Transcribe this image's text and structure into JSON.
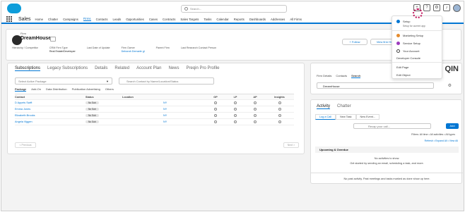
{
  "header": {
    "search_placeholder": "Search...",
    "utility_icons": [
      "add-icon",
      "help-icon",
      "setup-gear-icon",
      "bell-icon",
      "avatar-icon"
    ]
  },
  "nav": {
    "app_name": "Sales",
    "items": [
      "Home",
      "Chatter",
      "Campaigns",
      "Firms",
      "Contacts",
      "Leads",
      "Opportunities",
      "Cases",
      "Contracts",
      "Sales Targets",
      "Tasks",
      "Calendar",
      "Reports",
      "Dashboards",
      "Addresses",
      "All Firms"
    ],
    "active_index": 3
  },
  "record": {
    "type": "Firm",
    "name": "DreamHouse",
    "fields": [
      {
        "label": "Hierarchy / Competitor",
        "value": ""
      },
      {
        "label": "CRM Firm Type",
        "value": "Real Estate/Developer"
      },
      {
        "label": "Last Date of Update",
        "value": ""
      },
      {
        "label": "Firm Owner",
        "value": "Deborah Demarle gl"
      },
      {
        "label": "Parent Firm",
        "value": ""
      },
      {
        "label": "Last Research Contact Person",
        "value": ""
      }
    ],
    "follow_label": "+ Follow",
    "view_label": "View firm Hierarchy"
  },
  "left_panel": {
    "tabs": [
      "Subscriptions",
      "Legacy Subscriptions",
      "Details",
      "Related",
      "Account Plan",
      "News",
      "Preqin Pro Profile"
    ],
    "active_tab": 0,
    "package_placeholder": "Select Active Package",
    "contact_search_placeholder": "Search Contact by Name/Location/Status",
    "subtabs": [
      "Package",
      "Add-On",
      "Data Distribution",
      "Publication Advertising",
      "Others"
    ],
    "columns": [
      "Contact",
      "Status",
      "Location",
      "GP",
      "LP",
      "AP",
      "Insights"
    ],
    "rows": [
      {
        "contact": "D Appels Swift",
        "status": "No Sub",
        "location": "NY"
      },
      {
        "contact": "Emma Jones",
        "status": "No Sub",
        "location": "NY"
      },
      {
        "contact": "Elizabeth Brooks",
        "status": "No Sub",
        "location": "NY"
      },
      {
        "contact": "Angela Viggen",
        "status": "No Sub",
        "location": "NY"
      }
    ],
    "prev_label": "< Previous",
    "next_label": "Next >"
  },
  "right_panel_top": {
    "brand": "QIN",
    "tabs": [
      "Firm Details",
      "Contacts",
      "Search"
    ],
    "active_tab": 2,
    "search_value": "DreamHouse"
  },
  "activity": {
    "tabs": [
      "Activity",
      "Chatter"
    ],
    "buttons": [
      "Log a Call",
      "New Task",
      "New Event..."
    ],
    "call_placeholder": "Recap your call...",
    "add_label": "Add",
    "filters": "Filters: All time • All activities • All types",
    "links": "Refresh • Expand All • View All",
    "upcoming": "Upcoming & Overdue",
    "no_activities_1": "No activities to show.",
    "no_activities_2": "Get started by sending an email, scheduling a task, and more.",
    "past_activity": "No past activity. Past meetings and tasks marked as done show up here."
  },
  "setup_menu": {
    "items": [
      {
        "label": "Setup",
        "sub": "Setup for current app"
      },
      {
        "label": "Marketing Setup"
      },
      {
        "label": "Service Setup"
      },
      {
        "label": "Your Account"
      },
      {
        "label": "Developer Console"
      },
      {
        "label": "Edit Page"
      },
      {
        "label": "Edit Object"
      }
    ]
  },
  "colors": {
    "brand": "#0176d3",
    "cloud": "#0d9dda",
    "focus": "#c0125a"
  }
}
